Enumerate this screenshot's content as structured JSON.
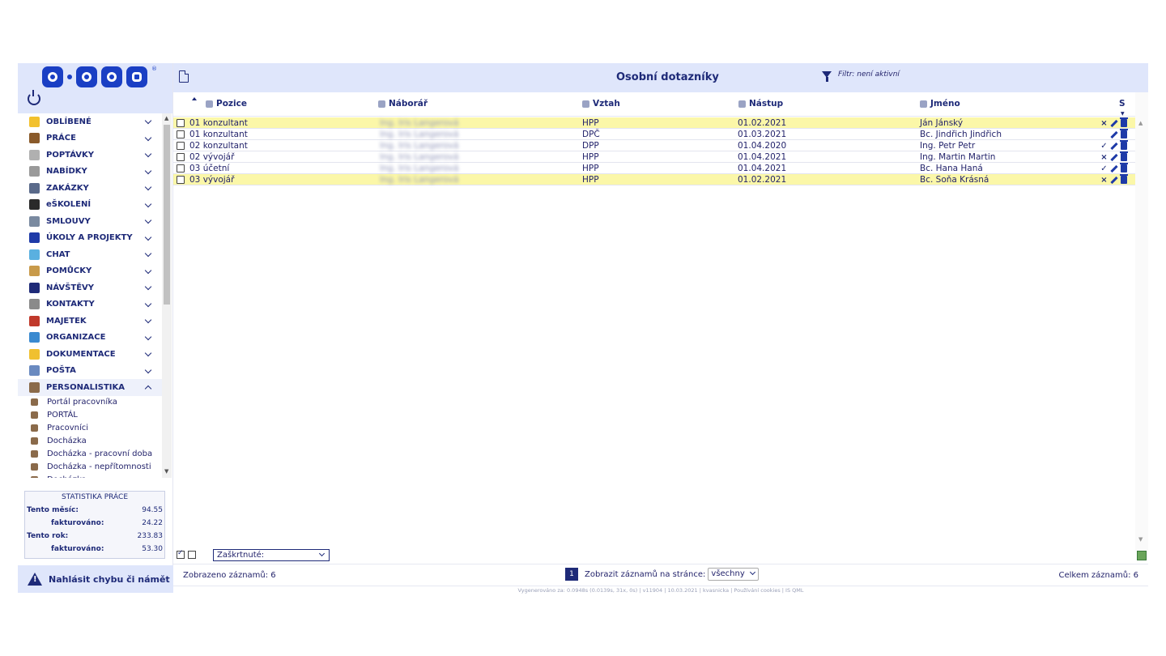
{
  "sidebar": {
    "logo_text": "Q·COM",
    "menu": [
      {
        "label": "OBLÍBENÉ",
        "color": "#f2c12e"
      },
      {
        "label": "PRÁCE",
        "color": "#8a5a2a"
      },
      {
        "label": "POPTÁVKY",
        "color": "#b0b0b0"
      },
      {
        "label": "NABÍDKY",
        "color": "#9a9a9a"
      },
      {
        "label": "ZAKÁZKY",
        "color": "#5a6a8a"
      },
      {
        "label": "eŠKOLENÍ",
        "color": "#2a2a2a"
      },
      {
        "label": "SMLOUVY",
        "color": "#7a8aa0"
      },
      {
        "label": "ÚKOLY A PROJEKTY",
        "color": "#1e3aa8"
      },
      {
        "label": "CHAT",
        "color": "#5ab0e0"
      },
      {
        "label": "POMŮCKY",
        "color": "#c89a4a"
      },
      {
        "label": "NÁVŠTĚVY",
        "color": "#1e2a78"
      },
      {
        "label": "KONTAKTY",
        "color": "#8a8a8a"
      },
      {
        "label": "MAJETEK",
        "color": "#c0392b"
      },
      {
        "label": "ORGANIZACE",
        "color": "#3a8ad0"
      },
      {
        "label": "DOKUMENTACE",
        "color": "#f0c030"
      },
      {
        "label": "POŠTA",
        "color": "#6a8ac0"
      },
      {
        "label": "PERSONALISTIKA",
        "color": "#8a6a4a",
        "open": true
      }
    ],
    "submenu": [
      "Portál pracovníka",
      "PORTÁL",
      "Pracovníci",
      "Docházka",
      "Docházka - pracovní doba",
      "Docházka - nepřítomnosti",
      "Docházka - ..."
    ],
    "stats": {
      "title": "STATISTIKA PRÁCE",
      "rows": [
        {
          "label": "Tento měsíc:",
          "value": "94.55",
          "indent": false
        },
        {
          "label": "fakturováno:",
          "value": "24.22",
          "indent": true
        },
        {
          "label": "Tento rok:",
          "value": "233.83",
          "indent": false
        },
        {
          "label": "fakturováno:",
          "value": "53.30",
          "indent": true
        }
      ]
    },
    "report_label": "Nahlásit chybu či námět"
  },
  "header": {
    "title": "Osobní dotazníky",
    "filter": "Filtr: není aktivní"
  },
  "table": {
    "columns": [
      "Pozice",
      "Náborář",
      "Vztah",
      "Nástup",
      "Jméno",
      "S"
    ],
    "rows": [
      {
        "pozice": "01  konzultant",
        "naborar": "Ing. Iris Langerová",
        "vztah": "HPP",
        "nastup": "01.02.2021",
        "jmeno": "Ján Jánský",
        "status": "×",
        "highlight": true
      },
      {
        "pozice": "01  konzultant",
        "naborar": "Ing. Iris Langerová",
        "vztah": "DPČ",
        "nastup": "01.03.2021",
        "jmeno": "Bc. Jindřich Jindřich",
        "status": "",
        "highlight": false
      },
      {
        "pozice": "02  konzultant",
        "naborar": "Ing. Iris Langerová",
        "vztah": "DPP",
        "nastup": "01.04.2020",
        "jmeno": "Ing. Petr Petr",
        "status": "✓",
        "highlight": false
      },
      {
        "pozice": "02  vývojář",
        "naborar": "Ing. Iris Langerová",
        "vztah": "HPP",
        "nastup": "01.04.2021",
        "jmeno": "Ing. Martin Martin",
        "status": "×",
        "highlight": false
      },
      {
        "pozice": "03  účetní",
        "naborar": "Ing. Iris Langerová",
        "vztah": "HPP",
        "nastup": "01.04.2021",
        "jmeno": "Bc. Hana Haná",
        "status": "✓",
        "highlight": false
      },
      {
        "pozice": "03  vývojář",
        "naborar": "Ing. Iris Langerová",
        "vztah": "HPP",
        "nastup": "01.02.2021",
        "jmeno": "Bc. Soňa Krásná",
        "status": "×",
        "highlight": true
      }
    ]
  },
  "tools": {
    "select_value": "Zaškrtnuté:"
  },
  "footer": {
    "shown": "Zobrazeno záznamů: 6",
    "page": "1",
    "per_page_label": "Zobrazit záznamů na stránce:",
    "per_page_value": "všechny",
    "total": "Celkem záznamů: 6",
    "credits": "Vygenerováno za: 0.0948s (0.0139s, 31x, 0s) | v11904 | 10.03.2021 | kvasnicka | Používání cookies | IS QML"
  },
  "colors": {
    "accent": "#1e2a78",
    "header_bg": "#dfe6fb",
    "row_highlight": "#fbf7a8"
  }
}
